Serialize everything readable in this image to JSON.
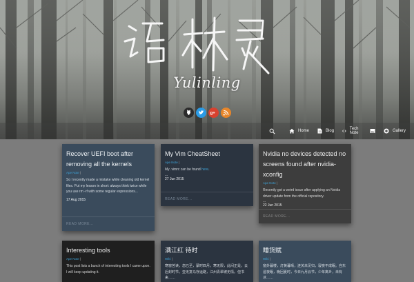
{
  "site": {
    "logo_cn": "语林灵",
    "logo_en": "Yulinling"
  },
  "social": [
    {
      "name": "github-icon",
      "glyph": "●"
    },
    {
      "name": "twitter-icon",
      "glyph": "t"
    },
    {
      "name": "google-plus-icon",
      "glyph": "g+"
    },
    {
      "name": "rss-icon",
      "glyph": ")"
    }
  ],
  "nav": {
    "home": "Home",
    "blog": "Blog",
    "technote": "Tech Note",
    "gallery": "Gallery"
  },
  "posts": [
    {
      "title": "Recover UEFI boot after removing all the kernels",
      "category": "Ape Note",
      "excerpt": "So I recently made a mistake while cleaning old kernel files. Put my lesson in short: always think twice while you use rm -rf with some regular expressions...",
      "date": "17 Aug 2015",
      "read_more": "READ MORE..."
    },
    {
      "title": "My Vim CheatSheet",
      "category": "Ape Note",
      "excerpt": "My .vimrc can be found",
      "excerpt_link": "here",
      "dots": "...",
      "date": "27 Jun 2015",
      "read_more": "READ MORE..."
    },
    {
      "title": "Nvidia no devices detected no screens found after nvidia-xconfig",
      "category": "Ape Note",
      "excerpt": "Recently got a weird issue after applying an Nvidia driver update from the official repository.",
      "dots": "...",
      "date": "22 Jun 2015",
      "read_more": "READ MORE..."
    },
    {
      "title": "Interesting tools",
      "category": "Ape Note",
      "excerpt": "This post lists a bunch of interesting tools I came upon. I will keep updating it."
    },
    {
      "title": "满江红 待时",
      "category": "Wiki",
      "excerpt": "寒窗苦读，忽已至，蒙时四月。寒无限，此间正是，云后封时节。亚无复马存运路，江州青翠坡无情。但书来……"
    },
    {
      "title": "睡货赋",
      "category": "Wiki",
      "excerpt": "窗外暮楼，灯黄暮晴，连关未见归，寝夜不成眠。自东遥夜眠，晚回夏时，今日九月云节，少年离乡，未有冰……"
    }
  ],
  "colors": {
    "page_bg": "#7c7c7c",
    "card_dark_blue": "#3a4b5c",
    "card_navy": "#2b3440",
    "card_charcoal": "#3d3d3d",
    "card_black": "#1f1f1f",
    "link": "#3ea3d8"
  }
}
